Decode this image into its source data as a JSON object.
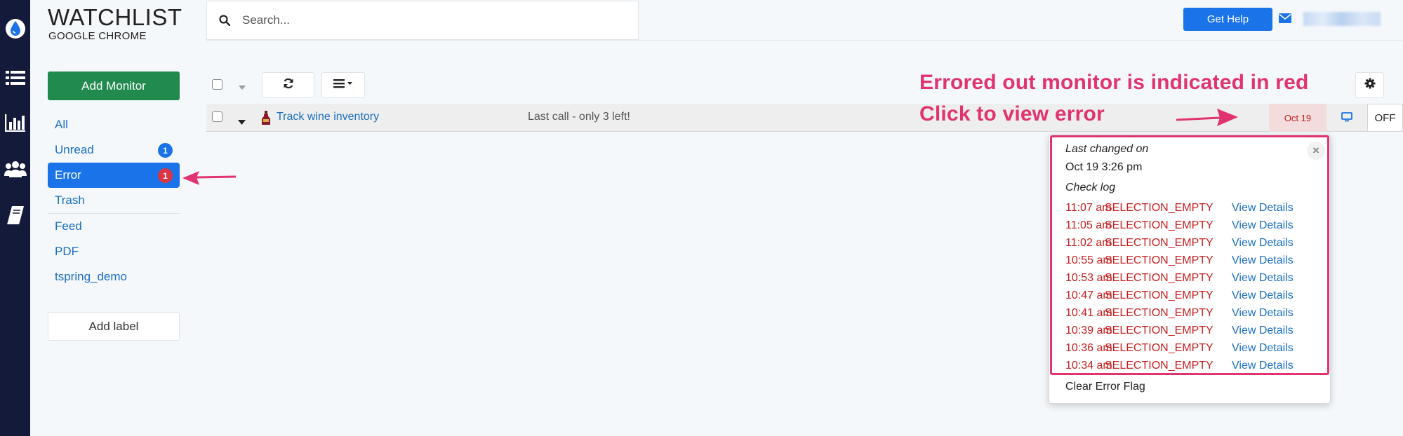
{
  "app": {
    "title": "WATCHLIST",
    "subtitle": "GOOGLE CHROME"
  },
  "rail": {
    "icons": [
      "water-drop-icon",
      "list-icon",
      "bar-chart-icon",
      "users-icon",
      "book-icon"
    ]
  },
  "search": {
    "placeholder": "Search...",
    "value": ""
  },
  "header": {
    "help_label": "Get Help"
  },
  "sidebar": {
    "add_monitor_label": "Add Monitor",
    "items": [
      {
        "label": "All",
        "badge": ""
      },
      {
        "label": "Unread",
        "badge": "1"
      },
      {
        "label": "Error",
        "badge": "1"
      },
      {
        "label": "Trash",
        "badge": ""
      },
      {
        "label": "Feed",
        "badge": ""
      },
      {
        "label": "PDF",
        "badge": ""
      },
      {
        "label": "tspring_demo",
        "badge": ""
      }
    ],
    "add_label_label": "Add label"
  },
  "monitor": {
    "title": "Track wine inventory",
    "snippet": "Last call - only 3 left!",
    "date": "Oct 19",
    "status": "OFF"
  },
  "annotations": {
    "line1": "Errored out monitor is indicated in red",
    "line2": "Click to view error"
  },
  "popup": {
    "last_changed_label": "Last changed on",
    "last_changed_value": "Oct 19 3:26 pm",
    "check_log_label": "Check log",
    "link_label": "View Details",
    "log": [
      {
        "time": "11:07 am",
        "code": "SELECTION_EMPTY"
      },
      {
        "time": "11:05 am",
        "code": "SELECTION_EMPTY"
      },
      {
        "time": "11:02 am",
        "code": "SELECTION_EMPTY"
      },
      {
        "time": "10:55 am",
        "code": "SELECTION_EMPTY"
      },
      {
        "time": "10:53 am",
        "code": "SELECTION_EMPTY"
      },
      {
        "time": "10:47 am",
        "code": "SELECTION_EMPTY"
      },
      {
        "time": "10:41 am",
        "code": "SELECTION_EMPTY"
      },
      {
        "time": "10:39 am",
        "code": "SELECTION_EMPTY"
      },
      {
        "time": "10:36 am",
        "code": "SELECTION_EMPTY"
      },
      {
        "time": "10:34 am",
        "code": "SELECTION_EMPTY"
      }
    ],
    "clear_label": "Clear Error Flag"
  },
  "colors": {
    "rail": "#141a3a",
    "primary": "#1a73e8",
    "success": "#218a4f",
    "error": "#c81e1e",
    "annotation": "#e0336f"
  }
}
